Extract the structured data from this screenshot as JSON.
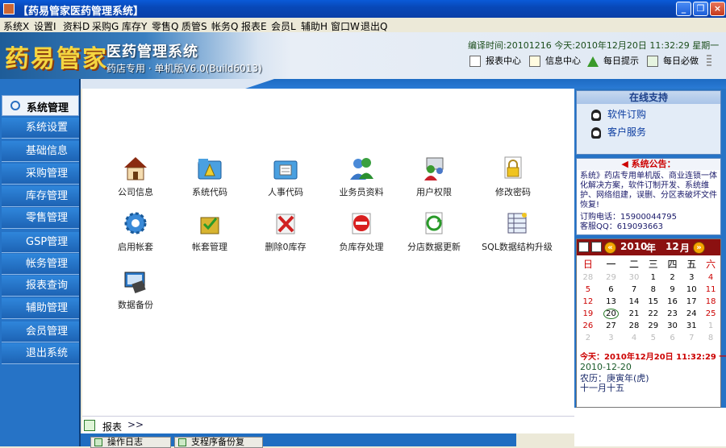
{
  "window": {
    "title": "【药易管家医药管理系统】",
    "buttons": [
      "_",
      "❐",
      "×"
    ]
  },
  "menu": [
    "系统X",
    "设置I",
    "资料D",
    "采购G",
    "库存Y",
    "零售Q",
    "质管S",
    "帐务Q",
    "报表E",
    "会员L",
    "辅助H",
    "窗口W",
    "退出Q"
  ],
  "header": {
    "logo": "药易管家",
    "subtitle": "医药管理系统",
    "edition": "药店专用 · 单机版V6.0(Build6013)",
    "compile_info": "编译时间:20101216    今天:2010年12月20日 11:32:29 星期一",
    "toolbar": [
      {
        "label": "报表中心",
        "icon": "report-center-icon"
      },
      {
        "label": "信息中心",
        "icon": "info-center-icon"
      },
      {
        "label": "每日提示",
        "icon": "daily-tip-icon"
      },
      {
        "label": "每日必做",
        "icon": "daily-task-icon"
      }
    ]
  },
  "sidebar": {
    "header": "系统管理",
    "items": [
      "系统设置",
      "基础信息",
      "采购管理",
      "库存管理",
      "零售管理",
      "GSP管理",
      "帐务管理",
      "报表查询",
      "辅助管理",
      "会员管理",
      "退出系统"
    ]
  },
  "modules": [
    {
      "label": "公司信息",
      "icon": "house-icon"
    },
    {
      "label": "系统代码",
      "icon": "folder-code-icon"
    },
    {
      "label": "人事代码",
      "icon": "personnel-icon"
    },
    {
      "label": "业务员资料",
      "icon": "users-icon"
    },
    {
      "label": "用户权限",
      "icon": "user-permission-icon"
    },
    {
      "label": "修改密码",
      "icon": "lock-icon"
    },
    {
      "label": "启用帐套",
      "icon": "gear-icon"
    },
    {
      "label": "帐套管理",
      "icon": "box-check-icon"
    },
    {
      "label": "删除0库存",
      "icon": "delete-icon"
    },
    {
      "label": "负库存处理",
      "icon": "no-entry-icon"
    },
    {
      "label": "分店数据更新",
      "icon": "refresh-icon"
    },
    {
      "label": "SQL数据结构升级",
      "icon": "database-upgrade-icon"
    },
    {
      "label": "数据备份",
      "icon": "backup-icon"
    }
  ],
  "bottom": {
    "report_label": "报表",
    "arrow": ">>",
    "tabs": [
      "操作日志",
      "支程序备份复"
    ]
  },
  "support": {
    "title": "在线支持",
    "items": [
      "软件订购",
      "客户服务"
    ]
  },
  "notice": {
    "title": "◀ 系统公告：",
    "text": "系统》药店专用单机版、商业连锁一体化解决方案，软件订制开发、系统维护、网络组建，误删、分区表破坏文件恢复!",
    "phone": "订购电话：15900044795",
    "qq": "客服QQ：619093663"
  },
  "calendar": {
    "year": "2010",
    "year_label": "年",
    "month": "12",
    "month_label": "月",
    "weekdays": [
      "日",
      "一",
      "二",
      "三",
      "四",
      "五",
      "六"
    ],
    "weeks": [
      [
        "28",
        "29",
        "30",
        "1",
        "2",
        "3",
        "4"
      ],
      [
        "5",
        "6",
        "7",
        "8",
        "9",
        "10",
        "11"
      ],
      [
        "12",
        "13",
        "14",
        "15",
        "16",
        "17",
        "18"
      ],
      [
        "19",
        "20",
        "21",
        "22",
        "23",
        "24",
        "25"
      ],
      [
        "26",
        "27",
        "28",
        "29",
        "30",
        "31",
        "1"
      ],
      [
        "2",
        "3",
        "4",
        "5",
        "6",
        "7",
        "8"
      ]
    ],
    "today_line": "今天：2010年12月20日 11:32:29  一",
    "date": "2010-12-20",
    "lunar": "农历：庚寅年(虎)",
    "lunar_day": "十一月十五"
  }
}
